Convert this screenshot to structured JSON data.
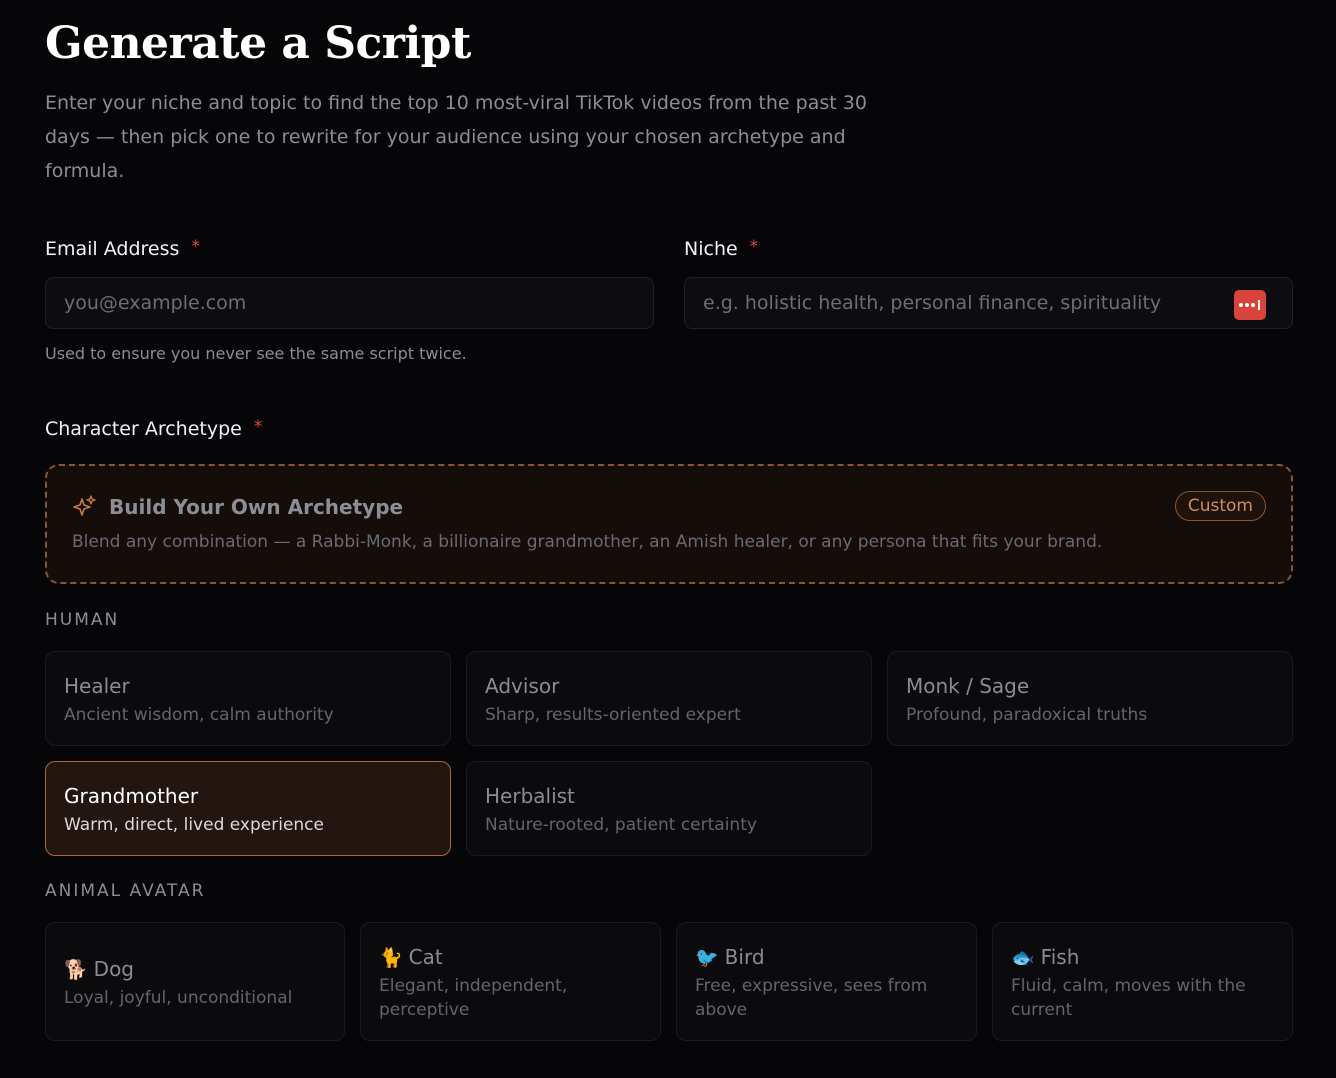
{
  "header": {
    "title": "Generate a Script",
    "subtitle": "Enter your niche and topic to find the top 10 most-viral TikTok videos from the past 30 days — then pick one to rewrite for your audience using your chosen archetype and formula."
  },
  "form": {
    "email": {
      "label": "Email Address",
      "required_mark": "*",
      "placeholder": "you@example.com",
      "value": "",
      "hint": "Used to ensure you never see the same script twice."
    },
    "niche": {
      "label": "Niche",
      "required_mark": "*",
      "placeholder": "e.g. holistic health, personal finance, spirituality",
      "value": "",
      "addon_icon": "password-manager-icon"
    },
    "archetype": {
      "label": "Character Archetype",
      "required_mark": "*",
      "custom": {
        "icon": "sparkles-icon",
        "title": "Build Your Own Archetype",
        "description": "Blend any combination — a Rabbi-Monk, a billionaire grandmother, an Amish healer, or any persona that fits your brand.",
        "badge": "Custom"
      },
      "human_section": "HUMAN",
      "human": [
        {
          "title": "Healer",
          "description": "Ancient wisdom, calm authority",
          "selected": false
        },
        {
          "title": "Advisor",
          "description": "Sharp, results-oriented expert",
          "selected": false
        },
        {
          "title": "Monk / Sage",
          "description": "Profound, paradoxical truths",
          "selected": false
        },
        {
          "title": "Grandmother",
          "description": "Warm, direct, lived experience",
          "selected": true
        },
        {
          "title": "Herbalist",
          "description": "Nature-rooted, patient certainty",
          "selected": false
        }
      ],
      "animal_section": "ANIMAL AVATAR",
      "animal": [
        {
          "emoji": "🐕",
          "title": "Dog",
          "description": "Loyal, joyful, unconditional"
        },
        {
          "emoji": "🐈",
          "title": "Cat",
          "description": "Elegant, independent, perceptive"
        },
        {
          "emoji": "🐦",
          "title": "Bird",
          "description": "Free, expressive, sees from above"
        },
        {
          "emoji": "🐟",
          "title": "Fish",
          "description": "Fluid, calm, moves with the current"
        }
      ]
    }
  },
  "colors": {
    "background": "#060608",
    "accent": "#a7683d",
    "required": "#e0463d",
    "password_addon": "#d8443c"
  }
}
